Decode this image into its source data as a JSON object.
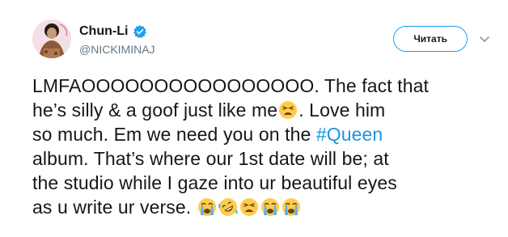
{
  "user": {
    "display_name": "Chun-Li",
    "handle": "@NICKIMINAJ",
    "verified": true,
    "avatar_icon": "profile-photo"
  },
  "actions": {
    "follow_label": "Читать",
    "menu_icon": "chevron-down-icon"
  },
  "tweet": {
    "line1": "LMFAOOOOOOOOOOOOOOOO. The fact that",
    "line2_a": "he’s silly & a goof just like me",
    "line2_b": ". Love him",
    "line3_a": "so much. Em we need you on the ",
    "hashtag": "#Queen",
    "line4": "album. That’s where our 1st date will be; at",
    "line5": "the studio while I gaze into ur beautiful eyes",
    "line6": "as u write ur verse. "
  },
  "colors": {
    "text": "#14171a",
    "secondary": "#657786",
    "link": "#1b95e0",
    "accent": "#1da1f2"
  }
}
